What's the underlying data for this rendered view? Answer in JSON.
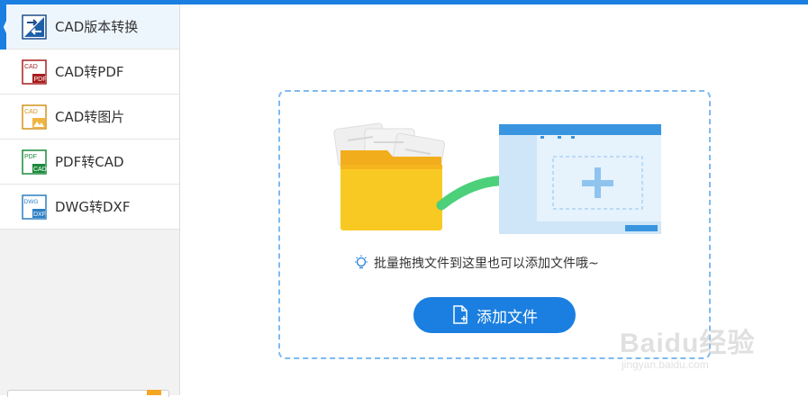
{
  "sidebar": {
    "items": [
      {
        "label": "CAD版本转换",
        "icon": "cad-version-convert-icon",
        "active": true
      },
      {
        "label": "CAD转PDF",
        "icon": "cad-to-pdf-icon",
        "icon_text_top": "CAD",
        "icon_text_bottom": "PDF"
      },
      {
        "label": "CAD转图片",
        "icon": "cad-to-image-icon",
        "icon_text_top": "CAD"
      },
      {
        "label": "PDF转CAD",
        "icon": "pdf-to-cad-icon",
        "icon_text_top": "PDF",
        "icon_text_bottom": "CAD"
      },
      {
        "label": "DWG转DXF",
        "icon": "dwg-to-dxf-icon",
        "icon_text_top": "DWG",
        "icon_text_bottom": "DXF"
      }
    ]
  },
  "main": {
    "hint_text": "批量拖拽文件到这里也可以添加文件哦~",
    "add_button_label": "添加文件"
  },
  "watermark": {
    "brand": "Baidu经验",
    "url": "jingyan.baidu.com"
  },
  "colors": {
    "accent": "#1a7fe0",
    "dashed_border": "#7fbaf0",
    "folder": "#f7c21b",
    "arrow": "#4cd07a"
  }
}
